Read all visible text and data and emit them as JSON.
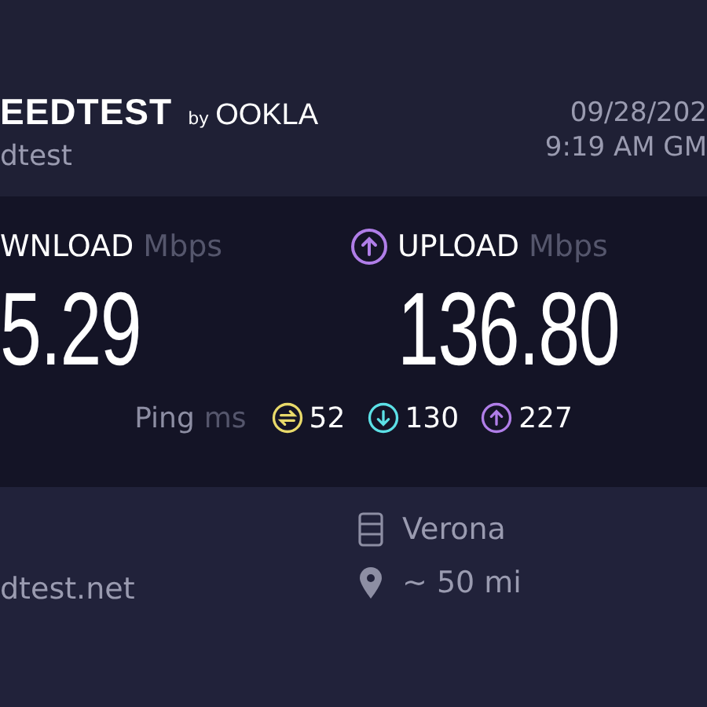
{
  "header": {
    "brand": "EEDTEST",
    "by": "by",
    "maker": "OOKLA",
    "subtitle": "dtest",
    "date": "09/28/202",
    "time": "9:19 AM GM"
  },
  "speeds": [
    {
      "kind": "download",
      "label": "WNLOAD",
      "unit": "Mbps",
      "value": "5.29"
    },
    {
      "kind": "upload",
      "label": "UPLOAD",
      "unit": "Mbps",
      "value": "136.80",
      "color": "#b07ee8"
    }
  ],
  "ping": {
    "label": "Ping",
    "unit": "ms",
    "values": [
      {
        "kind": "idle",
        "value": "52",
        "color": "#e8d96a"
      },
      {
        "kind": "download",
        "value": "130",
        "color": "#5ce0e6"
      },
      {
        "kind": "upload",
        "value": "227",
        "color": "#b07ee8"
      }
    ]
  },
  "provider": {
    "host": "dtest.net"
  },
  "server": {
    "name": "Verona",
    "distance": "~ 50 mi"
  }
}
